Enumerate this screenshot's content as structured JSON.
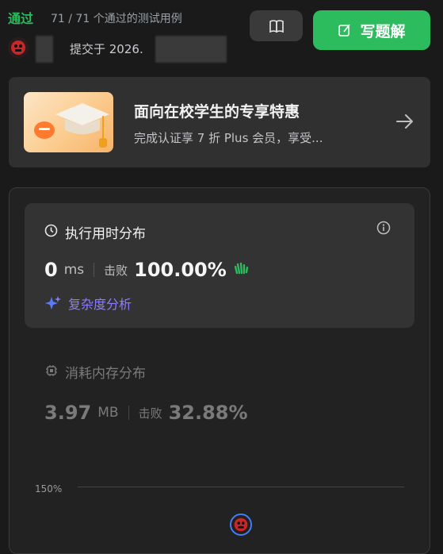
{
  "header": {
    "status": "通过",
    "cases": "71 / 71 个通过的测试用例",
    "submitted_prefix": "提交于 2026.",
    "solve_button": "写题解"
  },
  "promo": {
    "title": "面向在校学生的专享特惠",
    "subtitle": "完成认证享 7 折 Plus 会员，享受..."
  },
  "runtime": {
    "title": "执行用时分布",
    "value": "0",
    "unit": "ms",
    "beat_label": "击败",
    "beat_value": "100.00%",
    "complexity": "复杂度分析"
  },
  "memory": {
    "title": "消耗内存分布",
    "value": "3.97",
    "unit": "MB",
    "beat_label": "击败",
    "beat_value": "32.88%"
  },
  "chart": {
    "y_tick": "150%"
  },
  "colors": {
    "accent_green": "#2cbb5d",
    "complexity_purple": "#8c7dff"
  }
}
